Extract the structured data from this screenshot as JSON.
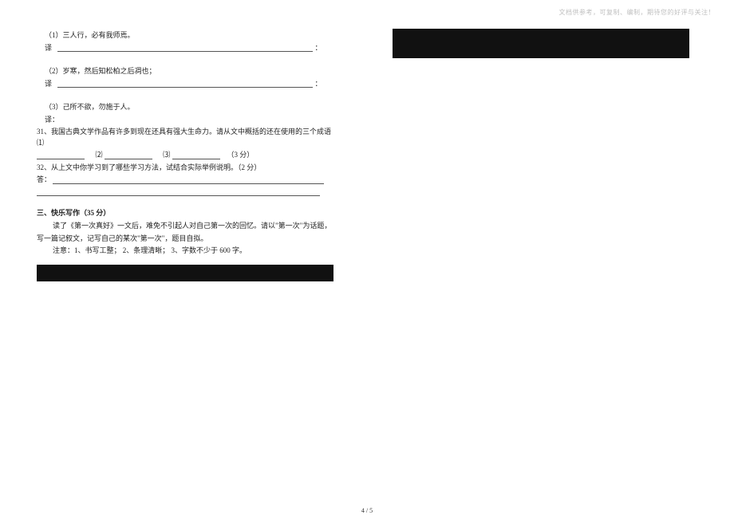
{
  "watermark": "文档供参考，可复制、编制，期待您的好评与关注！",
  "left": {
    "q1_label": "（1）三人行，必有我师焉。",
    "trans_label": "译",
    "colon": "：",
    "q2_label": "（2）岁寒，然后知松柏之后凋也；",
    "q3_label": "（3）己所不欲，勿施于人。",
    "trans_plain": "译：",
    "q31_a": "31、我国古典文学作品有许多到现在还具有强大生命力。请从文中概括的还在使用的三个成语 ⑴",
    "q31_b": "⑵",
    "q31_c": "⑶",
    "q31_pts": "（3 分）",
    "q32": "32、从上文中你学习到了哪些学习方法，试结合实际举例说明。（2 分）",
    "ans_label": "答：",
    "section3_title": "三、快乐写作（35 分）",
    "essay_l1": "读了《第一次真好》一文后，难免不引起人对自己第一次的回忆。请以\"第一次\"为话题，",
    "essay_l2": "写一篇记叙文，记写自己的某次\"第一次\"，题目自拟。",
    "essay_l3": "注意：1、书写工整； 2、条理清晰； 3、字数不少于 600 字。"
  },
  "pagenum": "4 / 5"
}
